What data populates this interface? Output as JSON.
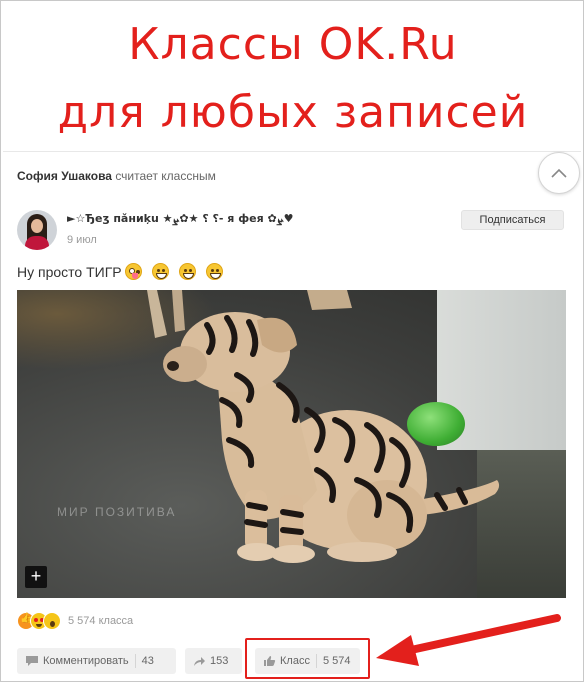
{
  "banner": {
    "line1": "Классы OK.Ru",
    "line2": "для любых записей",
    "color": "#e3201c"
  },
  "notice": {
    "user": "София Ушакова",
    "action": "считает классным"
  },
  "post": {
    "author": "►☆Ђеʒ пǎниķu ★ܨ✿★ ⸮ ⸮- я фея ✿ܨ♥",
    "date": "9 июл",
    "subscribe_label": "Подписаться",
    "text": "Ну просто ТИГР",
    "media_watermark": "МИР ПОЗИТИВА",
    "media_plus": "+"
  },
  "reactions": {
    "icons": [
      "like-icon",
      "love-icon",
      "wow-icon"
    ],
    "count_text": "5 574 класса"
  },
  "actions": {
    "comment_label": "Комментировать",
    "comment_count": "43",
    "share_count": "153",
    "class_label": "Класс",
    "class_count": "5 574"
  }
}
